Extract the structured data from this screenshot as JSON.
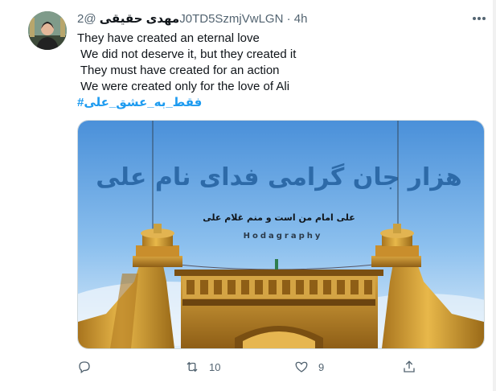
{
  "tweet": {
    "author_name": "مهدی حقیقی",
    "handle": "@2J0TD5SzmjVwLGN",
    "separator": "·",
    "time": "4h",
    "lines": [
      "They have created an eternal love",
      " We did not deserve it, but they created it",
      " They must have created for an action",
      " We were created only for the love of Ali"
    ],
    "hashtag": "#فقط_به_عشق_علی",
    "media": {
      "calligraphy": "هزار جان گرامی فدای نام علی",
      "subtitle": "علی امام من است و منم غلام علی",
      "watermark": "Hodagraphy"
    },
    "actions": {
      "reply_count": "",
      "retweet_count": "10",
      "like_count": "9"
    }
  },
  "colors": {
    "accent": "#1d9bf0",
    "secondary_text": "#536471",
    "primary_text": "#0f1419",
    "calligraphy": "#2d6aa8"
  }
}
